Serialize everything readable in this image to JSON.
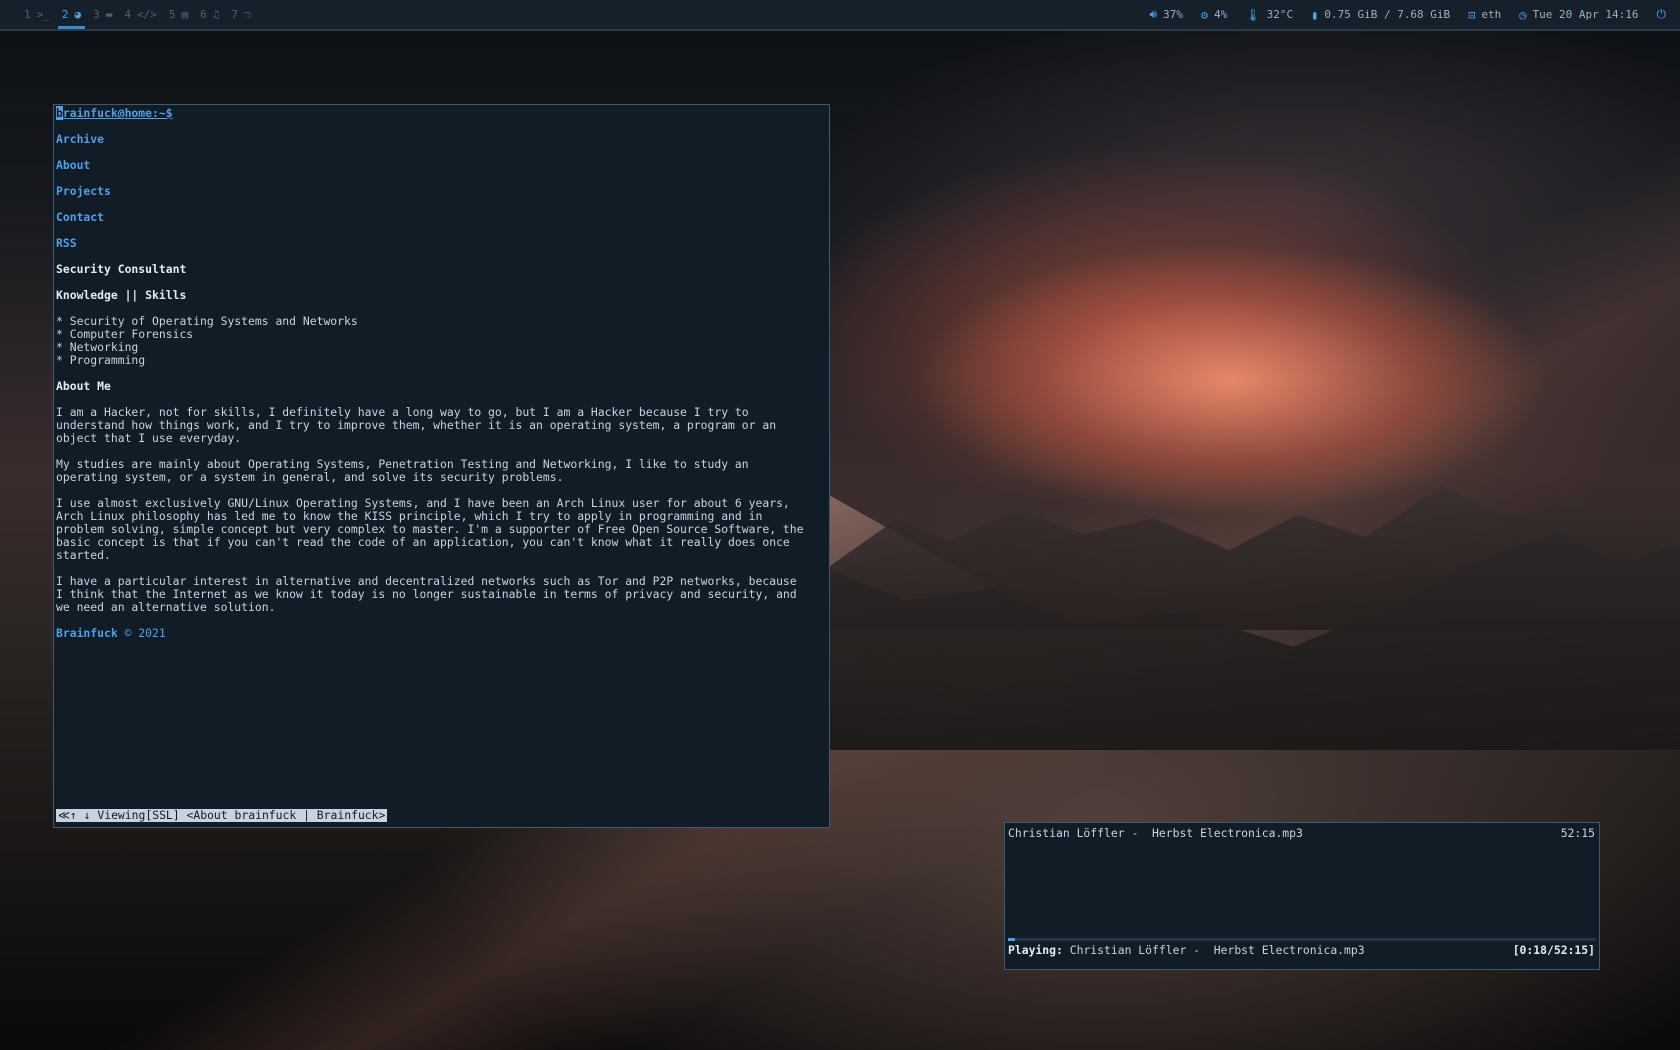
{
  "workspaces": [
    {
      "num": "1",
      "icon": ">_",
      "icon_name": "terminal-icon",
      "active": false
    },
    {
      "num": "2",
      "icon": "◕",
      "icon_name": "browser-icon",
      "active": true
    },
    {
      "num": "3",
      "icon": "▬",
      "icon_name": "folder-icon",
      "active": false
    },
    {
      "num": "4",
      "icon": "</>",
      "icon_name": "code-icon",
      "active": false
    },
    {
      "num": "5",
      "icon": "▤",
      "icon_name": "book-icon",
      "active": false
    },
    {
      "num": "6",
      "icon": "♫",
      "icon_name": "music-icon",
      "active": false
    },
    {
      "num": "7",
      "icon": "❐",
      "icon_name": "windows-icon",
      "active": false
    }
  ],
  "status": {
    "volume": "37%",
    "cpu": "4%",
    "temp": "32°C",
    "memory": "0.75 GiB / 7.68 GiB",
    "network": "eth",
    "datetime": "Tue 20 Apr 14:16"
  },
  "browser": {
    "prompt": "brainfuck@home:~$",
    "nav": [
      "Archive",
      "About",
      "Projects",
      "Contact",
      "RSS"
    ],
    "role": "Security Consultant",
    "skills_heading": "Knowledge || Skills",
    "skills": [
      "* Security of Operating Systems and Networks",
      "* Computer Forensics",
      "* Networking",
      "* Programming"
    ],
    "about_heading": "About Me",
    "paragraphs": [
      "I am a Hacker, not for skills, I definitely have a long way to go, but I am a Hacker because I try to\nunderstand how things work, and I try to improve them, whether it is an operating system, a program or an\nobject that I use everyday.",
      "My studies are mainly about Operating Systems, Penetration Testing and Networking, I like to study an\noperating system, or a system in general, and solve its security problems.",
      "I use almost exclusively GNU/Linux Operating Systems, and I have been an Arch Linux user for about 6 years,\nArch Linux philosophy has led me to know the KISS principle, which I try to apply in programming and in\nproblem solving, simple concept but very complex to master. I'm a supporter of Free Open Source Software, the\nbasic concept is that if you can't read the code of an application, you can't know what it really does once\nstarted.",
      "I have a particular interest in alternative and decentralized networks such as Tor and P2P networks, because\nI think that the Internet as we know it today is no longer sustainable in terms of privacy and security, and\nwe need an alternative solution."
    ],
    "footer_name": "Brainfuck",
    "footer_year": "© 2021",
    "statusline": "≪↑ ↓ Viewing[SSL] <About brainfuck | Brainfuck>"
  },
  "player": {
    "track": "Christian Löffler -  Herbst Electronica.mp3",
    "duration": "52:15",
    "playing_label": "Playing:",
    "playing_track": "Christian Löffler -  Herbst Electronica.mp3",
    "time": "[0:18/52:15]",
    "progress": 0.0057
  }
}
